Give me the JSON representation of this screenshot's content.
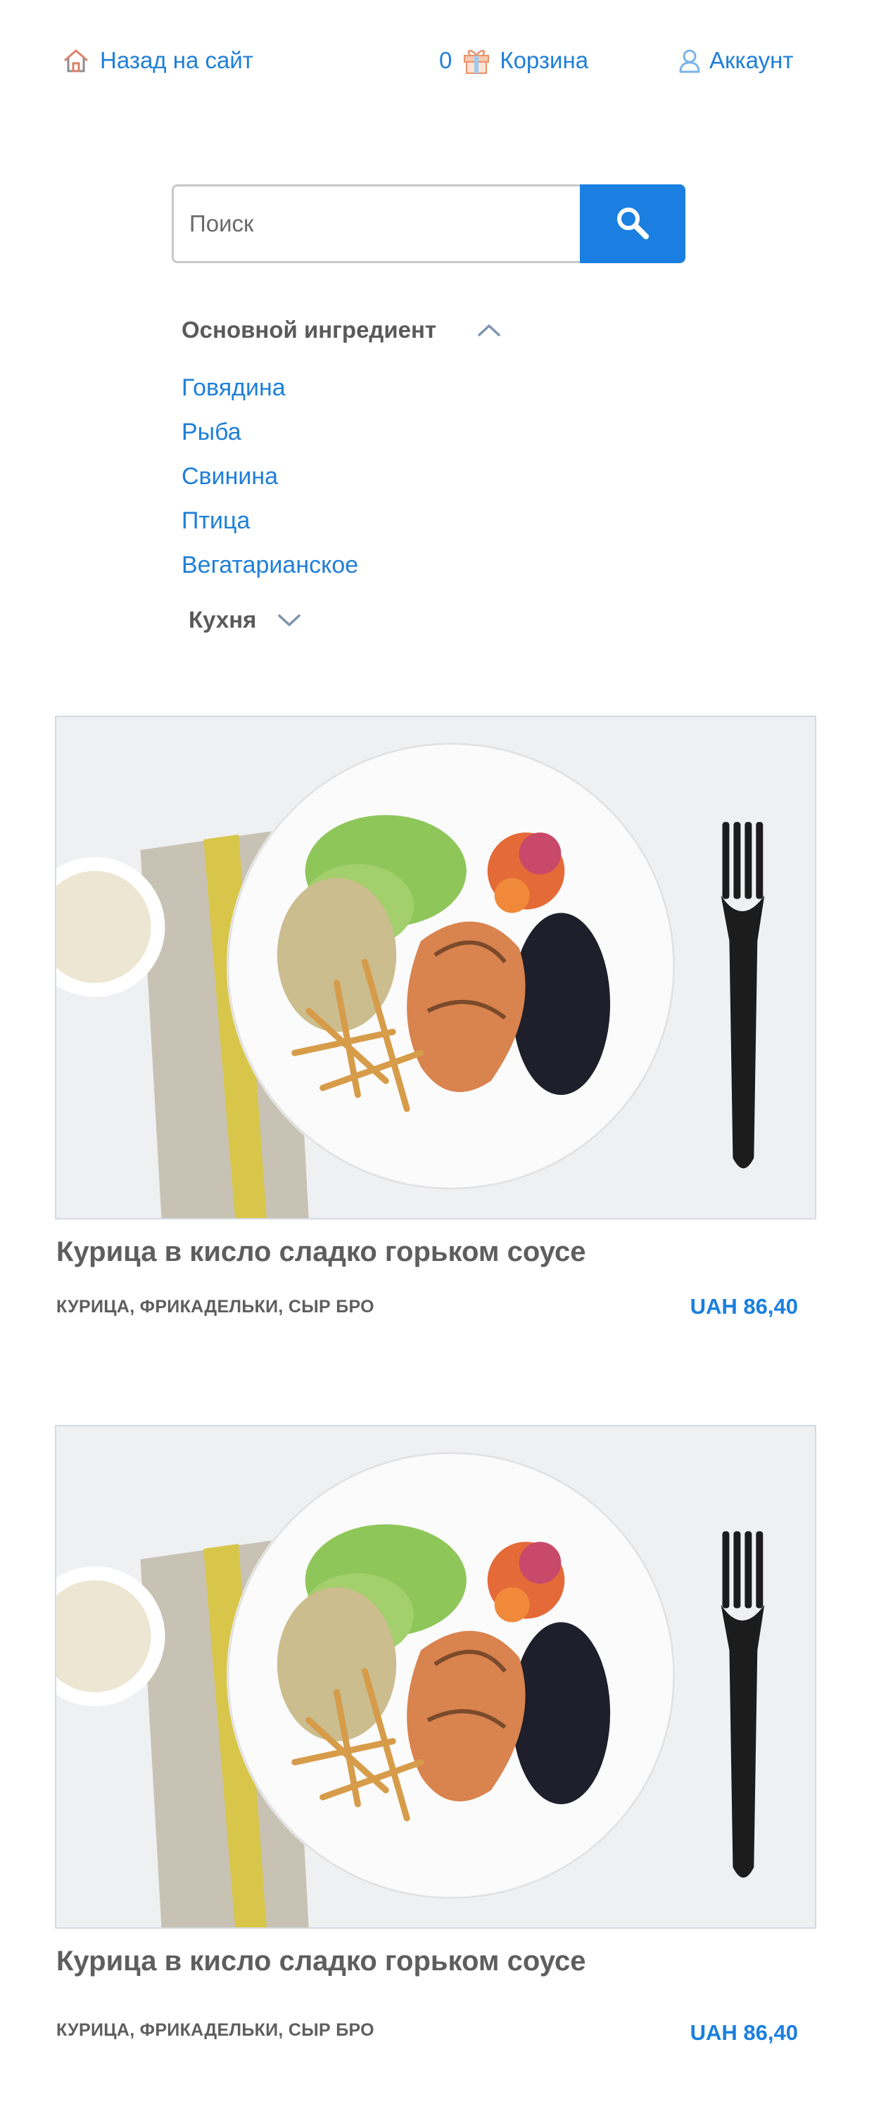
{
  "nav": {
    "back_label": "Назад на сайт",
    "cart_count": "0",
    "cart_label": "Корзина",
    "account_label": "Аккаунт"
  },
  "search": {
    "placeholder": "Поиск"
  },
  "filters": {
    "main_ingredient": {
      "title": "Основной ингредиент",
      "expanded": true,
      "items": [
        "Говядина",
        "Рыба",
        "Свинина",
        "Птица",
        "Вегатарианское"
      ]
    },
    "cuisine": {
      "title": "Кухня",
      "expanded": false
    }
  },
  "products": [
    {
      "title": "Курица в кисло сладко горьком соусе",
      "tags": "КУРИЦА, ФРИКАДЕЛЬКИ, СЫР БРО",
      "price": "UAH 86,40"
    },
    {
      "title": "Курица в кисло сладко горьком соусе",
      "tags": "КУРИЦА, ФРИКАДЕЛЬКИ, СЫР БРО",
      "price": "UAH 86,40"
    }
  ],
  "colors": {
    "accent": "#1a7fe0",
    "link": "#1f7fd8",
    "text": "#5b5b5b"
  }
}
